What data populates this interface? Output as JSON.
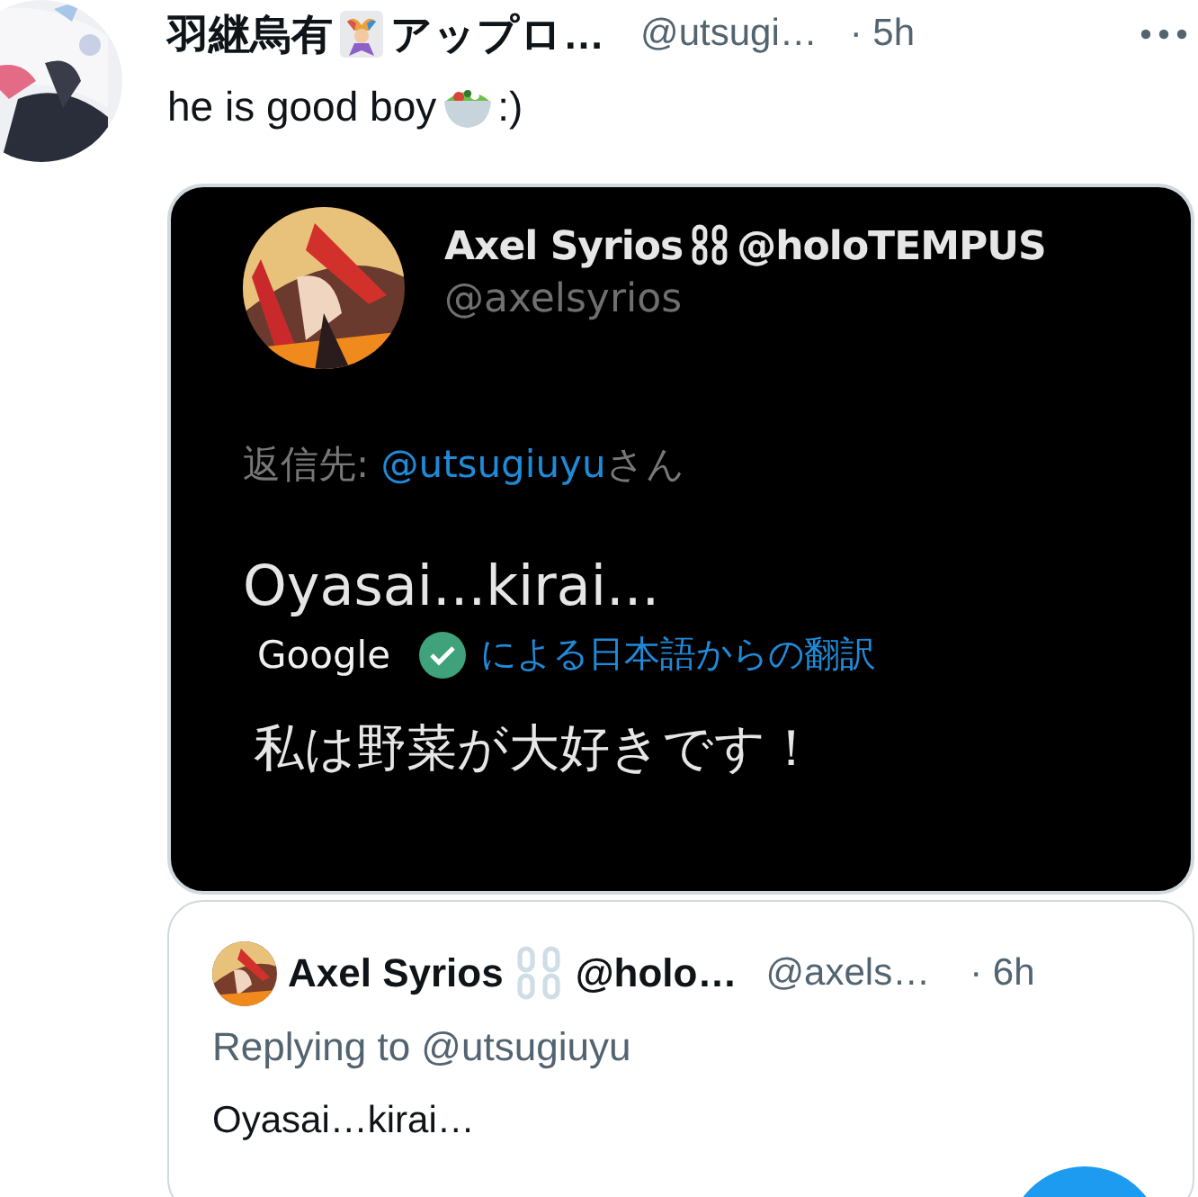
{
  "tweet": {
    "display_name": "羽継烏有",
    "display_name_rest": "アップロ…",
    "handle": "@utsugi…",
    "time": "· 5h",
    "text": "he is good boy",
    "text_end": ":)"
  },
  "screenshot": {
    "display_name": "Axel Syrios",
    "display_name_rest": "@holoTEMPUS",
    "handle": "@axelsyrios",
    "reply_prefix": "返信先: ",
    "reply_mention": "@utsugiuyu",
    "reply_suffix": "さん",
    "text": "Oyasai...kirai...",
    "translator": "Google",
    "translation_label": "による日本語からの翻訳",
    "translation": "私は野菜が大好きです！"
  },
  "quote": {
    "display_name": "Axel Syrios",
    "display_name_rest": "@holo…",
    "handle": "@axels…",
    "time": "· 6h",
    "replying": "Replying to @utsugiuyu",
    "text": "Oyasai…kirai…"
  }
}
